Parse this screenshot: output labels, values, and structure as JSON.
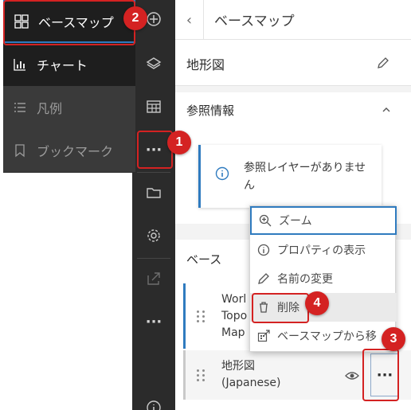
{
  "flyout": {
    "items": [
      {
        "label": "ベースマップ",
        "icon": "basemap-icon"
      },
      {
        "label": "チャート",
        "icon": "chart-icon"
      },
      {
        "label": "凡例",
        "icon": "legend-icon"
      },
      {
        "label": "ブックマーク",
        "icon": "bookmark-icon"
      }
    ]
  },
  "toolbar": {
    "icons": [
      "add-icon",
      "layers-icon",
      "table-icon",
      "more-icon",
      "folder-icon",
      "settings-icon",
      "share-icon",
      "more-icon",
      "info-icon"
    ]
  },
  "panel": {
    "header_title": "ベースマップ",
    "basemap_name": "地形図",
    "reference_section_title": "参照情報",
    "reference_notice": "参照レイヤーがありません",
    "base_section_title": "ベース",
    "layers": [
      {
        "title_lines": [
          "Worl",
          "Topo",
          "Map"
        ]
      },
      {
        "title_lines": [
          "地形図",
          "(Japanese)"
        ]
      }
    ]
  },
  "context_menu": {
    "items": [
      {
        "label": "ズーム",
        "icon": "zoom-icon"
      },
      {
        "label": "プロパティの表示",
        "icon": "info-icon"
      },
      {
        "label": "名前の変更",
        "icon": "pencil-icon"
      },
      {
        "label": "削除",
        "icon": "trash-icon"
      },
      {
        "label": "ベースマップから移",
        "icon": "move-icon"
      }
    ]
  },
  "annotations": [
    "1",
    "2",
    "3",
    "4"
  ],
  "colors": {
    "accent": "#2f7bbf",
    "toolbar_bg": "#2b2b2b",
    "callout": "#d42222"
  }
}
